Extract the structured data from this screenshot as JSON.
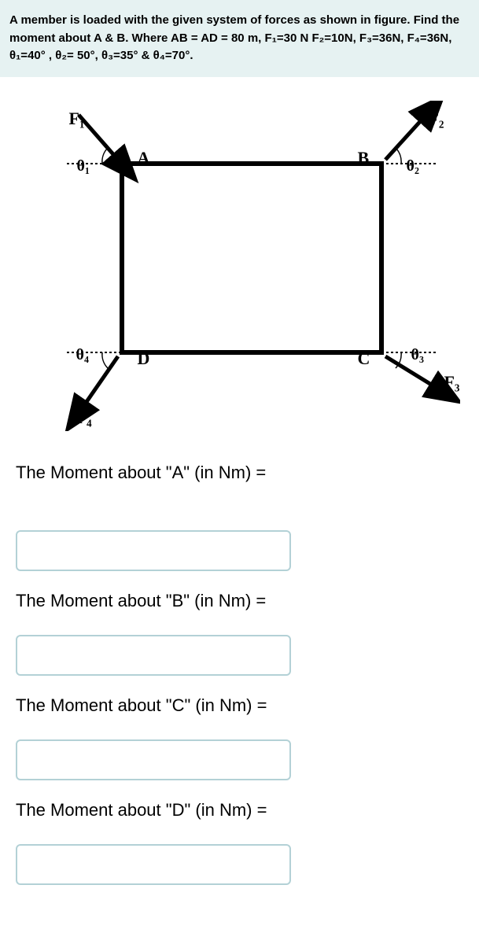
{
  "problem": {
    "text": "A member is loaded with the given system of forces as shown in figure. Find the moment about A & B. Where AB = AD = 80 m, F₁=30 N F₂=10N, F₃=36N, F₄=36N, θ₁=40° , θ₂= 50°, θ₃=35° & θ₄=70°."
  },
  "figure": {
    "F1": "F₁",
    "F2": "F₂",
    "F3": "F₃",
    "F4": "F₄",
    "A": "A",
    "B": "B",
    "C": "C",
    "D": "D",
    "theta1": "θ₁",
    "theta2": "θ₂",
    "theta3": "θ₃",
    "theta4": "θ₄"
  },
  "questions": {
    "qA": "The Moment about \"A\"  (in Nm) =",
    "qB": "The Moment about \"B\"  (in Nm) =",
    "qC": "The Moment about \"C\"  (in Nm) =",
    "qD": "The Moment about \"D\"  (in Nm) ="
  }
}
